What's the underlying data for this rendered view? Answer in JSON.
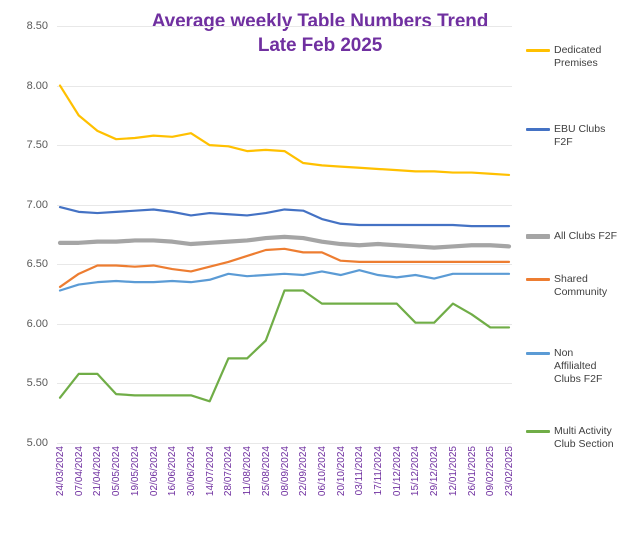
{
  "title": {
    "line1": "Average weekly Table Numbers Trend",
    "line2": "Late Feb 2025",
    "color": "#7030A0"
  },
  "axis": {
    "y_ticks": [
      "8.50",
      "8.00",
      "7.50",
      "7.00",
      "6.50",
      "6.00",
      "5.50",
      "5.00"
    ],
    "y_label_color": "#595959",
    "x_label_color": "#7030A0"
  },
  "legend": [
    {
      "label": "Dedicated\nPremises",
      "color": "#FFC000",
      "thick": false
    },
    {
      "label": "EBU Clubs\nF2F",
      "color": "#4472C4",
      "thick": false
    },
    {
      "label": "All Clubs F2F",
      "color": "#A5A5A5",
      "thick": true
    },
    {
      "label": "Shared\nCommunity",
      "color": "#ED7D31",
      "thick": false
    },
    {
      "label": "Non\nAffilialted\nClubs F2F",
      "color": "#5B9BD5",
      "thick": false
    },
    {
      "label": "Multi Activity\nClub Section",
      "color": "#70AD47",
      "thick": false
    }
  ],
  "chart_data": {
    "type": "line",
    "title": "Average weekly Table Numbers Trend Late Feb 2025",
    "xlabel": "",
    "ylabel": "",
    "ylim": [
      5.0,
      8.5
    ],
    "ytick_step": 0.5,
    "grid": true,
    "legend_position": "right",
    "categories": [
      "24/03/2024",
      "07/04/2024",
      "21/04/2024",
      "05/05/2024",
      "19/05/2024",
      "02/06/2024",
      "16/06/2024",
      "30/06/2024",
      "14/07/2024",
      "28/07/2024",
      "11/08/2024",
      "25/08/2024",
      "08/09/2024",
      "22/09/2024",
      "06/10/2024",
      "20/10/2024",
      "03/11/2024",
      "17/11/2024",
      "01/12/2024",
      "15/12/2024",
      "29/12/2024",
      "12/01/2025",
      "26/01/2025",
      "09/02/2025",
      "23/02/2025"
    ],
    "series": [
      {
        "name": "Dedicated Premises",
        "color": "#FFC000",
        "values": [
          8.0,
          7.75,
          7.62,
          7.55,
          7.56,
          7.58,
          7.57,
          7.6,
          7.5,
          7.49,
          7.45,
          7.46,
          7.45,
          7.35,
          7.33,
          7.32,
          7.31,
          7.3,
          7.29,
          7.28,
          7.28,
          7.27,
          7.27,
          7.26,
          7.25
        ]
      },
      {
        "name": "EBU Clubs F2F",
        "color": "#4472C4",
        "values": [
          6.98,
          6.94,
          6.93,
          6.94,
          6.95,
          6.96,
          6.94,
          6.91,
          6.93,
          6.92,
          6.91,
          6.93,
          6.96,
          6.95,
          6.88,
          6.84,
          6.83,
          6.83,
          6.83,
          6.83,
          6.83,
          6.83,
          6.82,
          6.82,
          6.82
        ]
      },
      {
        "name": "All Clubs F2F",
        "color": "#A5A5A5",
        "values": [
          6.68,
          6.68,
          6.69,
          6.69,
          6.7,
          6.7,
          6.69,
          6.67,
          6.68,
          6.69,
          6.7,
          6.72,
          6.73,
          6.72,
          6.69,
          6.67,
          6.66,
          6.67,
          6.66,
          6.65,
          6.64,
          6.65,
          6.66,
          6.66,
          6.65
        ]
      },
      {
        "name": "Shared Community",
        "color": "#ED7D31",
        "values": [
          6.31,
          6.42,
          6.49,
          6.49,
          6.48,
          6.49,
          6.46,
          6.44,
          6.48,
          6.52,
          6.57,
          6.62,
          6.63,
          6.6,
          6.6,
          6.53,
          6.52,
          6.52,
          6.52,
          6.52,
          6.52,
          6.52,
          6.52,
          6.52,
          6.52
        ]
      },
      {
        "name": "Non Affilialted Clubs F2F",
        "color": "#5B9BD5",
        "values": [
          6.28,
          6.33,
          6.35,
          6.36,
          6.35,
          6.35,
          6.36,
          6.35,
          6.37,
          6.42,
          6.4,
          6.41,
          6.42,
          6.41,
          6.44,
          6.41,
          6.45,
          6.41,
          6.39,
          6.41,
          6.38,
          6.42,
          6.42,
          6.42,
          6.42
        ]
      },
      {
        "name": "Multi Activity Club Section",
        "color": "#70AD47",
        "values": [
          5.38,
          5.58,
          5.58,
          5.41,
          5.4,
          5.4,
          5.4,
          5.4,
          5.35,
          5.71,
          5.71,
          5.86,
          6.28,
          6.28,
          6.17,
          6.17,
          6.17,
          6.17,
          6.17,
          6.01,
          6.01,
          6.17,
          6.08,
          5.97,
          5.97
        ]
      }
    ]
  }
}
